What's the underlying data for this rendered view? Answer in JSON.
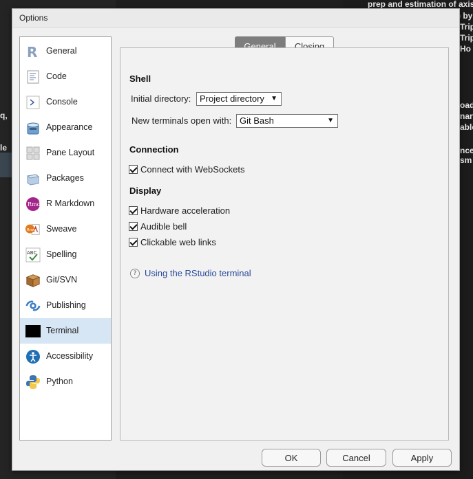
{
  "background": {
    "lines": [
      "prep and estimation of axis",
      ") by",
      "Trip",
      "Trip",
      "Ho",
      "oad",
      "nart",
      "able",
      "nce",
      "sm"
    ],
    "left_fragments": [
      "q,",
      "le"
    ]
  },
  "dialog": {
    "title": "Options"
  },
  "sidebar": {
    "items": [
      {
        "label": "General",
        "icon": "r-logo-icon"
      },
      {
        "label": "Code",
        "icon": "code-icon"
      },
      {
        "label": "Console",
        "icon": "console-icon"
      },
      {
        "label": "Appearance",
        "icon": "appearance-icon"
      },
      {
        "label": "Pane Layout",
        "icon": "pane-layout-icon"
      },
      {
        "label": "Packages",
        "icon": "packages-icon"
      },
      {
        "label": "R Markdown",
        "icon": "rmarkdown-icon"
      },
      {
        "label": "Sweave",
        "icon": "sweave-icon"
      },
      {
        "label": "Spelling",
        "icon": "spelling-icon"
      },
      {
        "label": "Git/SVN",
        "icon": "git-svn-icon"
      },
      {
        "label": "Publishing",
        "icon": "publishing-icon"
      },
      {
        "label": "Terminal",
        "icon": "terminal-icon"
      },
      {
        "label": "Accessibility",
        "icon": "accessibility-icon"
      },
      {
        "label": "Python",
        "icon": "python-icon"
      }
    ],
    "selected": "Terminal"
  },
  "tabs": {
    "general": "General",
    "closing": "Closing",
    "active": "General"
  },
  "shell": {
    "heading": "Shell",
    "initial_dir_label": "Initial directory:",
    "initial_dir_value": "Project directory",
    "new_terminals_label": "New terminals open with:",
    "new_terminals_value": "Git Bash"
  },
  "connection": {
    "heading": "Connection",
    "websockets_label": "Connect with WebSockets",
    "websockets_checked": true
  },
  "display": {
    "heading": "Display",
    "hw_accel_label": "Hardware acceleration",
    "hw_accel_checked": true,
    "audible_bell_label": "Audible bell",
    "audible_bell_checked": true,
    "web_links_label": "Clickable web links",
    "web_links_checked": true
  },
  "help": {
    "icon_glyph": "?",
    "link_text": "Using the RStudio terminal"
  },
  "buttons": {
    "ok": "OK",
    "cancel": "Cancel",
    "apply": "Apply"
  },
  "colors": {
    "selected_nav": "#d6e6f5",
    "active_tab": "#7d7d7d",
    "link": "#2a4a9a"
  }
}
